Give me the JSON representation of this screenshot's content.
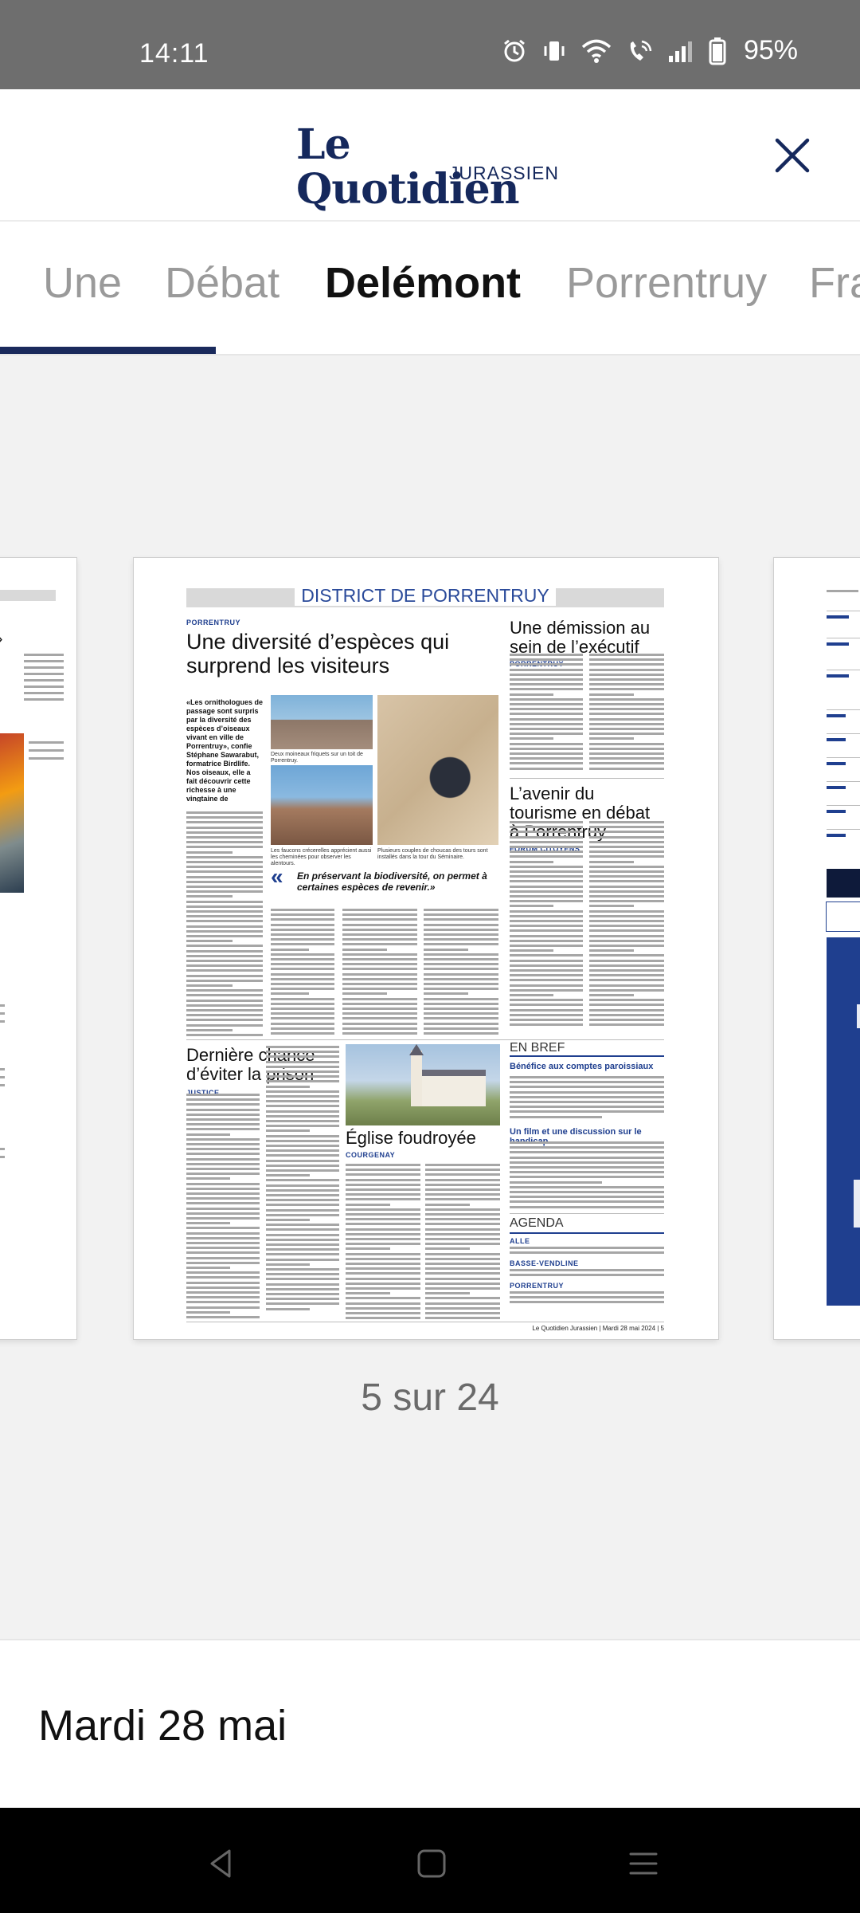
{
  "status_bar": {
    "time": "14:11",
    "battery_percent": "95%",
    "icons": [
      "alarm-icon",
      "vibrate-icon",
      "wifi-icon",
      "wifi-calling-icon",
      "signal-icon",
      "battery-icon"
    ]
  },
  "header": {
    "logo_main": "Le Quotidien",
    "logo_sub": "JURASSIEN",
    "close_icon": "close-icon"
  },
  "tabs": [
    {
      "label": "Une",
      "active": false
    },
    {
      "label": "Débat",
      "active": false
    },
    {
      "label": "Delémont",
      "active": true
    },
    {
      "label": "Porrentruy",
      "active": false
    },
    {
      "label": "Fra",
      "active": false
    }
  ],
  "newspaper_page": {
    "section_title": "DISTRICT DE PORRENTRUY",
    "main_article": {
      "kicker": "PORRENTRUY",
      "headline": "Une diversité d’espèces qui surprend les visiteurs",
      "lead": "«Les ornithologues de passage sont surpris par la diversité des espèces d’oiseaux vivant en ville de Porrentruy», confie Stéphane Sawarabut, formatrice Birdlife. Nos oiseaux, elle a fait découvrir cette richesse à une vingtaine de personnes, dans le cadre de la Fête de la nature.",
      "quote": "En préservant la biodiversité, on permet à certaines espèces de revenir.»",
      "caption_1": "Deux moineaux friquets sur un toit de Porrentruy.",
      "caption_2": "Les faucons crécerelles apprécient aussi les cheminées pour observer les alentours.",
      "caption_3": "Plusieurs couples de choucas des tours sont installés dans la tour du Séminaire."
    },
    "article_2": {
      "headline": "Une démission au sein de l’exécutif",
      "kicker": "PORRENTRUY"
    },
    "article_3": {
      "headline": "L’avenir du tourisme en débat à Porrentruy",
      "kicker": "FORUM CITOYENS"
    },
    "article_4": {
      "headline": "Dernière chance d’éviter la prison",
      "kicker": "JUSTICE"
    },
    "article_5": {
      "headline": "Église foudroyée",
      "kicker": "COURGENAY"
    },
    "brief": {
      "title": "EN BREF",
      "item_1": "Bénéfice aux comptes paroissiaux",
      "item_2": "Un film et une discussion sur le handicap"
    },
    "agenda": {
      "title": "AGENDA",
      "items": [
        "ALLE",
        "BASSE-VENDLINE",
        "PORRENTRUY"
      ]
    },
    "footer": "Le Quotidien Jurassien | Mardi 28 mai 2024 | 5"
  },
  "page_indicator": "5 sur 24",
  "date_label": "Mardi 28 mai",
  "nav_bar": {
    "buttons": [
      "back-icon",
      "home-icon",
      "recents-icon"
    ]
  }
}
